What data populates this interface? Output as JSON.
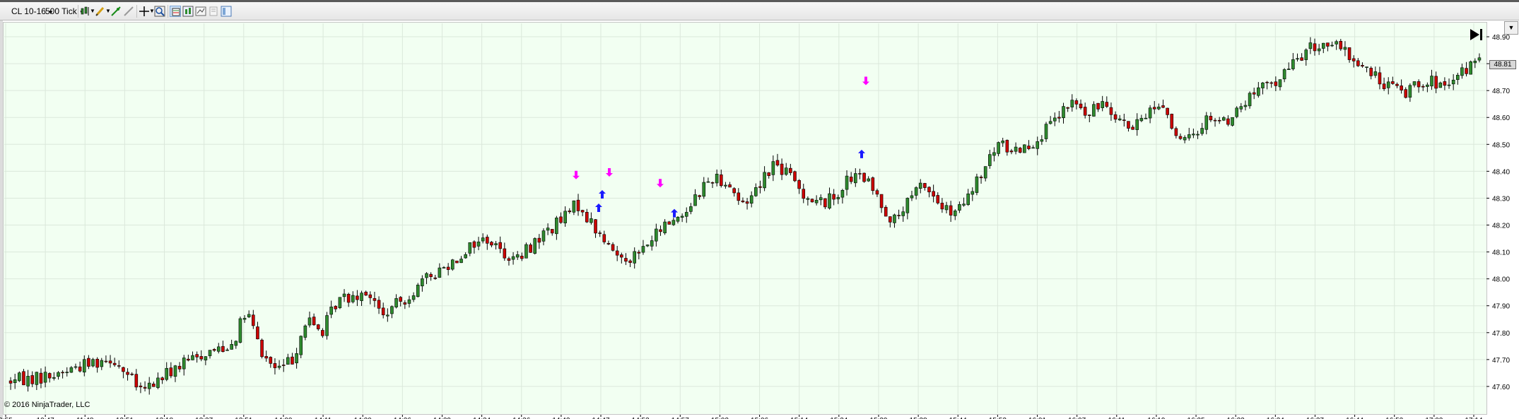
{
  "toolbar": {
    "instrument": "CL 10-16",
    "interval": "500 Tick"
  },
  "copyright": "© 2016 NinjaTrader, LLC",
  "last_price": "48.81",
  "colors": {
    "background": "#f2fff2",
    "grid": "#dbe8db",
    "up_candle": "#2e8b2e",
    "down_candle": "#cc0000",
    "buy_arrow": "#1a1aff",
    "sell_arrow": "#ff00ff"
  },
  "chart_data": {
    "type": "candlestick",
    "ylim": [
      47.5,
      48.95
    ],
    "yticks": [
      "47.60",
      "47.70",
      "47.80",
      "47.90",
      "48.00",
      "48.10",
      "48.20",
      "48.30",
      "48.40",
      "48.50",
      "48.60",
      "48.70",
      "48.80",
      "48.90"
    ],
    "xticks": [
      "9:55",
      "10:47",
      "11:48",
      "12:51",
      "13:18",
      "13:37",
      "13:51",
      "14:00",
      "14:11",
      "14:20",
      "14:26",
      "14:29",
      "14:34",
      "14:36",
      "14:42",
      "14:47",
      "14:53",
      "14:57",
      "15:02",
      "15:06",
      "15:14",
      "15:24",
      "15:30",
      "15:38",
      "15:44",
      "15:53",
      "16:01",
      "16:07",
      "16:11",
      "16:19",
      "16:25",
      "16:32",
      "16:34",
      "16:37",
      "16:44",
      "16:52",
      "17:02",
      "17:14"
    ],
    "grid": true,
    "price_path": [
      [
        0,
        47.62
      ],
      [
        3,
        47.64
      ],
      [
        5,
        47.68
      ],
      [
        7,
        47.71
      ],
      [
        9,
        47.58
      ],
      [
        11,
        47.66
      ],
      [
        13,
        47.72
      ],
      [
        15,
        47.76
      ],
      [
        16,
        47.88
      ],
      [
        17,
        47.72
      ],
      [
        18,
        47.66
      ],
      [
        19,
        47.7
      ],
      [
        20,
        47.85
      ],
      [
        21,
        47.8
      ],
      [
        22,
        47.92
      ],
      [
        23,
        47.94
      ],
      [
        24,
        47.96
      ],
      [
        25,
        47.86
      ],
      [
        27,
        47.95
      ],
      [
        28,
        48.0
      ],
      [
        29,
        48.04
      ],
      [
        30,
        48.08
      ],
      [
        31,
        48.13
      ],
      [
        32,
        48.15
      ],
      [
        33,
        48.1
      ],
      [
        34,
        48.07
      ],
      [
        35,
        48.13
      ],
      [
        36,
        48.18
      ],
      [
        37,
        48.22
      ],
      [
        38,
        48.28
      ],
      [
        39,
        48.2
      ],
      [
        40,
        48.12
      ],
      [
        41,
        48.08
      ],
      [
        42,
        48.09
      ],
      [
        43,
        48.15
      ],
      [
        44,
        48.21
      ],
      [
        45,
        48.24
      ],
      [
        46,
        48.32
      ],
      [
        47,
        48.38
      ],
      [
        48,
        48.36
      ],
      [
        49,
        48.27
      ],
      [
        50,
        48.35
      ],
      [
        51,
        48.43
      ],
      [
        52,
        48.39
      ],
      [
        53,
        48.32
      ],
      [
        54,
        48.28
      ],
      [
        55,
        48.3
      ],
      [
        56,
        48.37
      ],
      [
        57,
        48.38
      ],
      [
        58,
        48.3
      ],
      [
        59,
        48.21
      ],
      [
        60,
        48.28
      ],
      [
        61,
        48.36
      ],
      [
        62,
        48.28
      ],
      [
        63,
        48.23
      ],
      [
        64,
        48.3
      ],
      [
        65,
        48.4
      ],
      [
        66,
        48.5
      ],
      [
        67,
        48.48
      ],
      [
        68,
        48.5
      ],
      [
        69,
        48.54
      ],
      [
        70,
        48.6
      ],
      [
        71,
        48.66
      ],
      [
        72,
        48.6
      ],
      [
        73,
        48.67
      ],
      [
        74,
        48.6
      ],
      [
        75,
        48.55
      ],
      [
        76,
        48.63
      ],
      [
        77,
        48.65
      ],
      [
        78,
        48.5
      ],
      [
        79,
        48.53
      ],
      [
        80,
        48.61
      ],
      [
        81,
        48.58
      ],
      [
        82,
        48.63
      ],
      [
        83,
        48.69
      ],
      [
        84,
        48.72
      ],
      [
        85,
        48.76
      ],
      [
        86,
        48.83
      ],
      [
        87,
        48.86
      ],
      [
        88,
        48.88
      ],
      [
        89,
        48.84
      ],
      [
        90,
        48.8
      ],
      [
        91,
        48.75
      ],
      [
        92,
        48.72
      ],
      [
        93,
        48.69
      ],
      [
        94,
        48.74
      ],
      [
        95,
        48.73
      ],
      [
        96,
        48.7
      ],
      [
        97,
        48.78
      ],
      [
        98,
        48.81
      ]
    ],
    "sell_arrows": [
      [
        815,
        48.37
      ],
      [
        862,
        48.38
      ],
      [
        934,
        48.34
      ],
      [
        1225,
        48.72
      ]
    ],
    "buy_arrows": [
      [
        847,
        48.28
      ],
      [
        852,
        48.33
      ],
      [
        954,
        48.26
      ],
      [
        1219,
        48.48
      ]
    ]
  }
}
